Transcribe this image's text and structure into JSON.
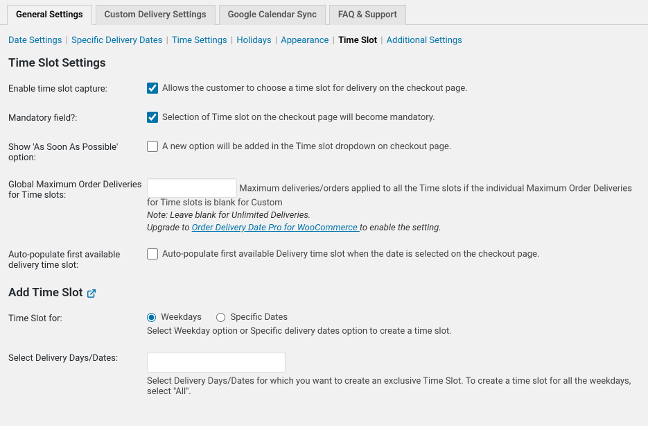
{
  "tabs": [
    {
      "label": "General Settings",
      "active": true
    },
    {
      "label": "Custom Delivery Settings",
      "active": false
    },
    {
      "label": "Google Calendar Sync",
      "active": false
    },
    {
      "label": "FAQ & Support",
      "active": false
    }
  ],
  "subnav": {
    "items": [
      {
        "label": "Date Settings",
        "current": false
      },
      {
        "label": "Specific Delivery Dates",
        "current": false
      },
      {
        "label": "Time Settings",
        "current": false
      },
      {
        "label": "Holidays",
        "current": false
      },
      {
        "label": "Appearance",
        "current": false
      },
      {
        "label": "Time Slot",
        "current": true
      },
      {
        "label": "Additional Settings",
        "current": false
      }
    ]
  },
  "section1_title": "Time Slot Settings",
  "rows": {
    "enable_capture": {
      "label": "Enable time slot capture:",
      "checked": true,
      "text": "Allows the customer to choose a time slot for delivery on the checkout page."
    },
    "mandatory": {
      "label": "Mandatory field?:",
      "checked": true,
      "text": "Selection of Time slot on the checkout page will become mandatory."
    },
    "asap": {
      "label": "Show 'As Soon As Possible' option:",
      "checked": false,
      "text": "A new option will be added in the Time slot dropdown on checkout page."
    },
    "global_max": {
      "label": "Global Maximum Order Deliveries for Time slots:",
      "input_value": "",
      "trail_text": "Maximum deliveries/orders applied to all the Time slots if the individual Maximum Order Deliveries for Time slots is blank for Custom",
      "note1": "Note: Leave blank for Unlimited Deliveries.",
      "note2_prefix": "Upgrade to ",
      "note2_link": "Order Delivery Date Pro for WooCommerce ",
      "note2_suffix": "to enable the setting."
    },
    "auto_populate": {
      "label": "Auto-populate first available delivery time slot:",
      "checked": false,
      "text": "Auto-populate first available Delivery time slot when the date is selected on the checkout page."
    }
  },
  "section2_title": "Add Time Slot",
  "timeslot_for": {
    "label": "Time Slot for:",
    "option_weekdays": "Weekdays",
    "option_specific": "Specific Dates",
    "selected": "weekdays",
    "desc": "Select Weekday option or Specific delivery dates option to create a time slot."
  },
  "select_days": {
    "label": "Select Delivery Days/Dates:",
    "desc": "Select Delivery Days/Dates for which you want to create an exclusive Time Slot. To create a time slot for all the weekdays, select \"All\"."
  }
}
